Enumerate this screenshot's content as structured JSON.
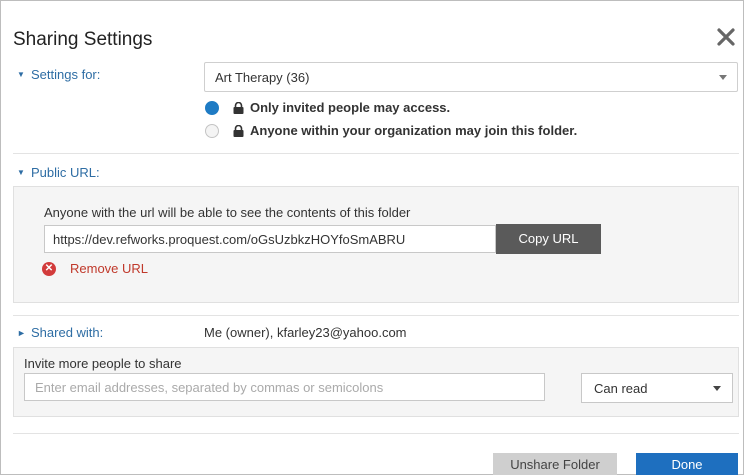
{
  "dialog": {
    "title": "Sharing Settings",
    "close_icon": "close-icon"
  },
  "settings": {
    "label": "Settings for:",
    "folder_selected": "Art Therapy (36)",
    "options": [
      {
        "label": "Only invited people may access.",
        "selected": true
      },
      {
        "label": "Anyone within your organization may join this folder.",
        "selected": false
      }
    ]
  },
  "public_url": {
    "label": "Public URL:",
    "caption": "Anyone with the url will be able to see the contents of this folder",
    "value": "https://dev.refworks.proquest.com/oGsUzbkzHOYfoSmABRU",
    "copy_label": "Copy URL",
    "remove_label": "Remove URL"
  },
  "shared_with": {
    "label": "Shared with:",
    "value": "Me (owner), kfarley23@yahoo.com"
  },
  "invite": {
    "title": "Invite more people to share",
    "placeholder": "Enter email addresses, separated by commas or semicolons",
    "permission_selected": "Can read"
  },
  "footer": {
    "unshare_label": "Unshare Folder",
    "done_label": "Done"
  },
  "colors": {
    "accent": "#1e6fbf",
    "link": "#2e6da4",
    "danger": "#d23b3b"
  }
}
